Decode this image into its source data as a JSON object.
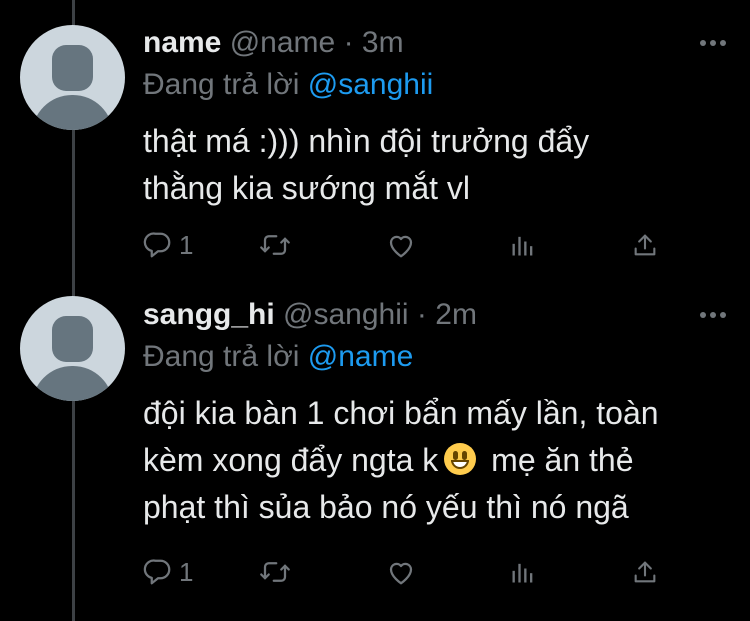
{
  "colors": {
    "background": "#000000",
    "text_primary": "#e7e9ea",
    "text_secondary": "#71767b",
    "mention": "#1d9bf0",
    "thread_line": "#3d4145",
    "avatar_bg": "#ccd6dd"
  },
  "tweets": [
    {
      "display_name": "name",
      "handle": "@name",
      "separator": "·",
      "time": "3m",
      "reply_prefix": "Đang trả lời",
      "reply_to": "@sanghii",
      "text_lines": [
        "thật má :))) nhìn đội trưởng đẩy",
        "thằng kia sướng mắt vl"
      ],
      "reply_count": "1",
      "icons": [
        "default-avatar-icon",
        "more-horizontal-icon",
        "reply-icon",
        "retweet-icon",
        "like-icon",
        "views-icon",
        "share-icon"
      ]
    },
    {
      "display_name": "sangg_hi",
      "handle": "@sanghii",
      "separator": "·",
      "time": "2m",
      "reply_prefix": "Đang trả lời",
      "reply_to": "@name",
      "text_lines": [
        "đội kia bàn 1 chơi bẩn mấy lần, toàn",
        "kèm xong đẩy ngta k",
        "mẹ ăn thẻ",
        "phạt thì sủa bảo nó yếu thì nó ngã"
      ],
      "emoji": "grinning-face-emoji",
      "reply_count": "1",
      "icons": [
        "default-avatar-icon",
        "more-horizontal-icon",
        "reply-icon",
        "retweet-icon",
        "like-icon",
        "views-icon",
        "share-icon"
      ]
    }
  ]
}
